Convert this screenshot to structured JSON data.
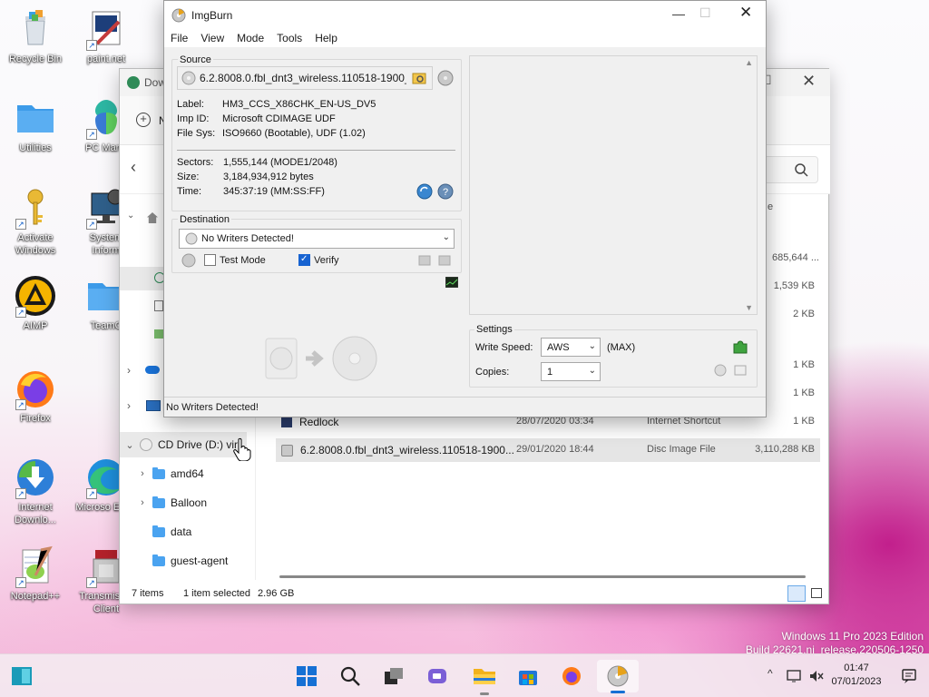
{
  "desktop": {
    "icons": [
      {
        "name": "recycle-bin",
        "label": "Recycle Bin"
      },
      {
        "name": "paintnet",
        "label": "paint.net"
      },
      {
        "name": "utilities",
        "label": "Utilities"
      },
      {
        "name": "pc-manager",
        "label": "PC Mana"
      },
      {
        "name": "activate-windows",
        "label": "Activate Windows"
      },
      {
        "name": "system-info",
        "label": "System Inform"
      },
      {
        "name": "aimp",
        "label": "AIMP"
      },
      {
        "name": "teamc",
        "label": "TeamC"
      },
      {
        "name": "firefox",
        "label": "Firefox"
      },
      {
        "name": "internet-download",
        "label": "Internet Downlo..."
      },
      {
        "name": "microsoft-edge",
        "label": "Microso Edge"
      },
      {
        "name": "notepadpp",
        "label": "Notepad++"
      },
      {
        "name": "transmission",
        "label": "Transmis Qt Client"
      }
    ],
    "watermark_line1": "Windows 11 Pro 2023 Edition",
    "watermark_line2": "Build 22621.ni_release.220506-1250"
  },
  "explorer": {
    "title": "Dow",
    "new_label": "N",
    "nav": [
      "CD Drive (D:) vir",
      "amd64",
      "Balloon",
      "data",
      "guest-agent"
    ],
    "files": [
      {
        "name": "",
        "date": "",
        "type": "",
        "size": "685,644 ..."
      },
      {
        "name": "",
        "date": "",
        "type": "",
        "size": "1,539 KB"
      },
      {
        "name": "",
        "date": "",
        "type": "",
        "size": "2 KB"
      },
      {
        "name": "",
        "date": "",
        "type": "",
        "size": "1 KB"
      },
      {
        "name": "",
        "date": "",
        "type": "",
        "size": "1 KB"
      },
      {
        "name": "Redlock",
        "date": "28/07/2020 03:34",
        "type": "Internet Shortcut",
        "size": "1 KB"
      },
      {
        "name": "6.2.8008.0.fbl_dnt3_wireless.110518-1900...",
        "date": "29/01/2020 18:44",
        "type": "Disc Image File",
        "size": "3,110,288 KB"
      }
    ],
    "col_size_header": "e",
    "status_items": "7 items",
    "status_selected": "1 item selected",
    "status_size": "2.96 GB"
  },
  "imgburn": {
    "title": "ImgBurn",
    "menu": [
      "File",
      "View",
      "Mode",
      "Tools",
      "Help"
    ],
    "source_label": "Source",
    "source_path": "6.2.8008.0.fbl_dnt3_wireless.110518-1900_...",
    "info": [
      {
        "k": "Label:",
        "v": "HM3_CCS_X86CHK_EN-US_DV5"
      },
      {
        "k": "Imp ID:",
        "v": "Microsoft CDIMAGE UDF"
      },
      {
        "k": "File Sys:",
        "v": "ISO9660 (Bootable), UDF (1.02)"
      }
    ],
    "info2": [
      {
        "k": "Sectors:",
        "v": "1,555,144 (MODE1/2048)"
      },
      {
        "k": "Size:",
        "v": "3,184,934,912 bytes"
      },
      {
        "k": "Time:",
        "v": "345:37:19 (MM:SS:FF)"
      }
    ],
    "destination_label": "Destination",
    "destination_value": "No Writers Detected!",
    "test_mode_label": "Test Mode",
    "verify_label": "Verify",
    "settings_label": "Settings",
    "write_speed_label": "Write Speed:",
    "write_speed_value": "AWS",
    "write_speed_max": "(MAX)",
    "copies_label": "Copies:",
    "copies_value": "1",
    "status": "No Writers Detected!",
    "verify_checked": true,
    "test_mode_checked": false
  },
  "taskbar": {
    "time": "01:47",
    "date": "07/01/2023"
  }
}
